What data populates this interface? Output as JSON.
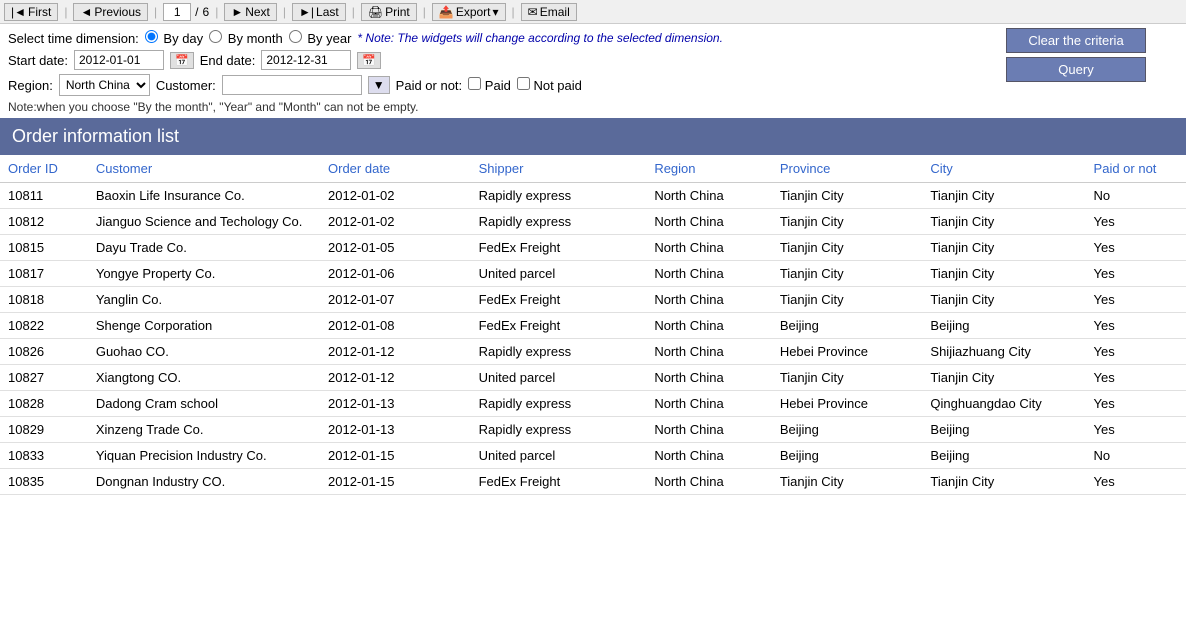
{
  "toolbar": {
    "first_label": "First",
    "previous_label": "Previous",
    "page_current": "1",
    "page_sep": "/",
    "page_total": "6",
    "next_label": "Next",
    "last_label": "Last",
    "print_label": "Print",
    "export_label": "Export",
    "export_arrow": "▾",
    "email_label": "Email"
  },
  "controls": {
    "time_dimension_label": "Select time dimension:",
    "by_day_label": "By day",
    "by_month_label": "By month",
    "by_year_label": "By year",
    "note": "* Note: The widgets will change according to the selected dimension.",
    "start_date_label": "Start date:",
    "start_date_value": "2012-01-01",
    "end_date_label": "End date:",
    "end_date_value": "2012-12-31",
    "region_label": "Region:",
    "region_value": "North China",
    "customer_label": "Customer:",
    "customer_value": "",
    "paid_label": "Paid or not:",
    "paid_option": "Paid",
    "not_paid_option": "Not paid",
    "warn_note": "Note:when you choose \"By the month\", \"Year\" and \"Month\" can not be empty.",
    "clear_btn": "Clear the criteria",
    "query_btn": "Query"
  },
  "table": {
    "title": "Order information list",
    "columns": [
      "Order ID",
      "Customer",
      "Order date",
      "Shipper",
      "Region",
      "Province",
      "City",
      "Paid or not"
    ],
    "rows": [
      {
        "order_id": "10811",
        "customer": "Baoxin Life Insurance Co.",
        "order_date": "2012-01-02",
        "shipper": "Rapidly express",
        "region": "North China",
        "province": "Tianjin City",
        "city": "Tianjin City",
        "paid": "No"
      },
      {
        "order_id": "10812",
        "customer": "Jianguo Science and Techology Co.",
        "order_date": "2012-01-02",
        "shipper": "Rapidly express",
        "region": "North China",
        "province": "Tianjin City",
        "city": "Tianjin City",
        "paid": "Yes"
      },
      {
        "order_id": "10815",
        "customer": "Dayu Trade Co.",
        "order_date": "2012-01-05",
        "shipper": "FedEx Freight",
        "region": "North China",
        "province": "Tianjin City",
        "city": "Tianjin City",
        "paid": "Yes"
      },
      {
        "order_id": "10817",
        "customer": "Yongye Property Co.",
        "order_date": "2012-01-06",
        "shipper": "United parcel",
        "region": "North China",
        "province": "Tianjin City",
        "city": "Tianjin City",
        "paid": "Yes"
      },
      {
        "order_id": "10818",
        "customer": "Yanglin Co.",
        "order_date": "2012-01-07",
        "shipper": "FedEx Freight",
        "region": "North China",
        "province": "Tianjin City",
        "city": "Tianjin City",
        "paid": "Yes"
      },
      {
        "order_id": "10822",
        "customer": "Shenge Corporation",
        "order_date": "2012-01-08",
        "shipper": "FedEx Freight",
        "region": "North China",
        "province": "Beijing",
        "city": "Beijing",
        "paid": "Yes"
      },
      {
        "order_id": "10826",
        "customer": "Guohao CO.",
        "order_date": "2012-01-12",
        "shipper": "Rapidly express",
        "region": "North China",
        "province": "Hebei Province",
        "city": "Shijiazhuang City",
        "paid": "Yes"
      },
      {
        "order_id": "10827",
        "customer": "Xiangtong CO.",
        "order_date": "2012-01-12",
        "shipper": "United parcel",
        "region": "North China",
        "province": "Tianjin City",
        "city": "Tianjin City",
        "paid": "Yes"
      },
      {
        "order_id": "10828",
        "customer": "Dadong Cram school",
        "order_date": "2012-01-13",
        "shipper": "Rapidly express",
        "region": "North China",
        "province": "Hebei Province",
        "city": "Qinghuangdao City",
        "paid": "Yes"
      },
      {
        "order_id": "10829",
        "customer": "Xinzeng Trade Co.",
        "order_date": "2012-01-13",
        "shipper": "Rapidly express",
        "region": "North China",
        "province": "Beijing",
        "city": "Beijing",
        "paid": "Yes"
      },
      {
        "order_id": "10833",
        "customer": "Yiquan  Precision Industry Co.",
        "order_date": "2012-01-15",
        "shipper": "United parcel",
        "region": "North China",
        "province": "Beijing",
        "city": "Beijing",
        "paid": "No"
      },
      {
        "order_id": "10835",
        "customer": "Dongnan Industry CO.",
        "order_date": "2012-01-15",
        "shipper": "FedEx Freight",
        "region": "North China",
        "province": "Tianjin City",
        "city": "Tianjin City",
        "paid": "Yes"
      }
    ]
  }
}
